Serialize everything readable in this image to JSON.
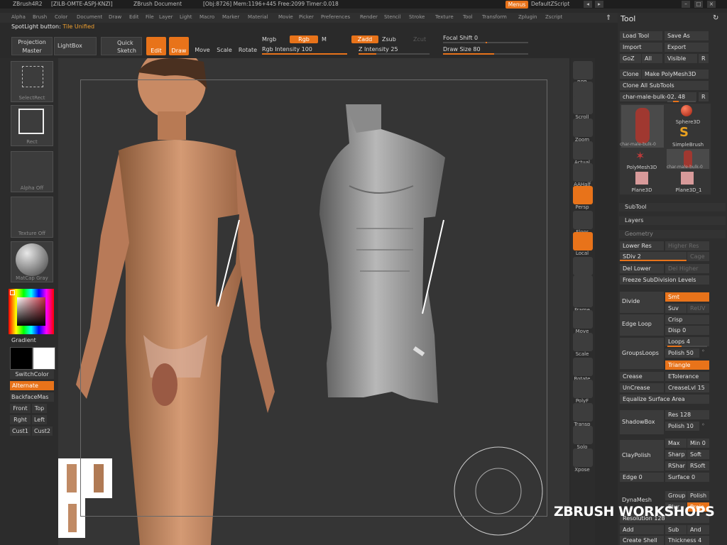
{
  "titlebar": {
    "app": "ZBrush4R2",
    "id": "[ZILB-OMTE-ASPJ-KNZI]",
    "doc": "ZBrush Document",
    "stats": "[Obj:8726] Mem:1196+445 Free:2099 Timer:0.018",
    "menus_btn": "Menus",
    "script": "DefaultZScript"
  },
  "menu": [
    "Alpha",
    "Brush",
    "Color",
    "Document",
    "Draw",
    "Edit",
    "File",
    "Layer",
    "Light",
    "Macro",
    "Marker",
    "Material",
    "Movie",
    "Picker",
    "Preferences",
    "Render",
    "Stencil",
    "Stroke",
    "Texture",
    "Tool",
    "Transform",
    "Zplugin",
    "Zscript"
  ],
  "spotlight": {
    "label": "SpotLight button:",
    "value": "Tile Unified"
  },
  "shelf": {
    "projection_master": "Projection Master",
    "lightbox": "LightBox",
    "quick_sketch": "Quick Sketch",
    "edit": "Edit",
    "draw": "Draw",
    "move": "Move",
    "scale": "Scale",
    "rotate": "Rotate",
    "mrgb": "Mrgb",
    "rgb": "Rgb",
    "m": "M",
    "zadd": "Zadd",
    "zsub": "Zsub",
    "zcut": "Zcut",
    "rgb_intensity": "Rgb Intensity 100",
    "z_intensity": "Z Intensity 25",
    "focal_shift": "Focal Shift 0",
    "draw_size": "Draw Size 80",
    "rgb_intensity_level": 1.0,
    "z_intensity_level": 0.25,
    "draw_size_level": 0.6
  },
  "lefttray": {
    "selectrect": "SelectRect",
    "rect": "Rect",
    "alpha_off": "Alpha Off",
    "texture_off": "Texture Off",
    "matcap": "MatCap Gray",
    "gradient": "Gradient",
    "switchcolor": "SwitchColor",
    "alternate": "Alternate",
    "backfacemask": "BackfaceMas",
    "front": "Front",
    "top": "Top",
    "right": "Rght",
    "left": "Left",
    "cust1": "Cust1",
    "cust2": "Cust2"
  },
  "righttray": [
    "BPR",
    "SPix",
    "Scroll",
    "Zoom",
    "Actual",
    "AAHalf",
    "Persp",
    "Floor",
    "Local",
    "L.Sym",
    "XYZ",
    "Frame",
    "Move",
    "Scale",
    "Rotate",
    "PolyF",
    "Transp",
    "Solo",
    "Xpose"
  ],
  "tool": {
    "title": "Tool",
    "load": "Load Tool",
    "save": "Save As",
    "import": "Import",
    "export": "Export",
    "goz": "GoZ",
    "all": "All",
    "visible": "Visible",
    "r": "R",
    "clone": "Clone",
    "make_poly": "Make PolyMesh3D",
    "clone_all": "Clone All SubTools",
    "current": "char-male-bulk-02. 48",
    "thumbs": [
      "char-male-bulk-0",
      "Sphere3D",
      "SimpleBrush",
      "PolyMesh3D",
      "char-male-bulk-0",
      "Plane3D",
      "Plane3D_1"
    ],
    "subtool": "SubTool",
    "layers": "Layers",
    "geometry": "Geometry",
    "lower_res": "Lower Res",
    "higher_res": "Higher Res",
    "sdiv": "SDiv 2",
    "cage": "Cage",
    "del_lower": "Del Lower",
    "del_higher": "Del Higher",
    "freeze": "Freeze SubDivision Levels",
    "divide": "Divide",
    "smt": "Smt",
    "suv": "Suv",
    "reuv": "ReUV",
    "edge_loop": "Edge Loop",
    "crisp": "Crisp",
    "disp": "Disp 0",
    "loops": "Loops 4",
    "grouploops": "GroupsLoops",
    "polish": "Polish 50",
    "triangle": "Triangle",
    "crease": "Crease",
    "etolerance": "ETolerance",
    "uncrease": "UnCrease",
    "creaselvl": "CreaseLvl 15",
    "equalize": "Equalize Surface Area",
    "shadowbox": "ShadowBox",
    "res": "Res 128",
    "polish10": "Polish 10",
    "claypolish": "ClayPolish",
    "max": "Max",
    "min": "Min 0",
    "sharp": "Sharp",
    "soft": "Soft",
    "rshar": "RShar",
    "rsoft": "RSoft",
    "edge": "Edge 0",
    "surface": "Surface 0",
    "dynamesh": "DynaMesh",
    "group": "Group",
    "polish_btn": "Polish",
    "blur": "Blur",
    "project": "Proje",
    "resolution": "Resolution 128",
    "add": "Add",
    "sub": "Sub",
    "and": "And",
    "create_shell": "Create Shell",
    "thickness": "Thickness 4"
  },
  "watermark": "ZBRUSH WORKSHOPS"
}
